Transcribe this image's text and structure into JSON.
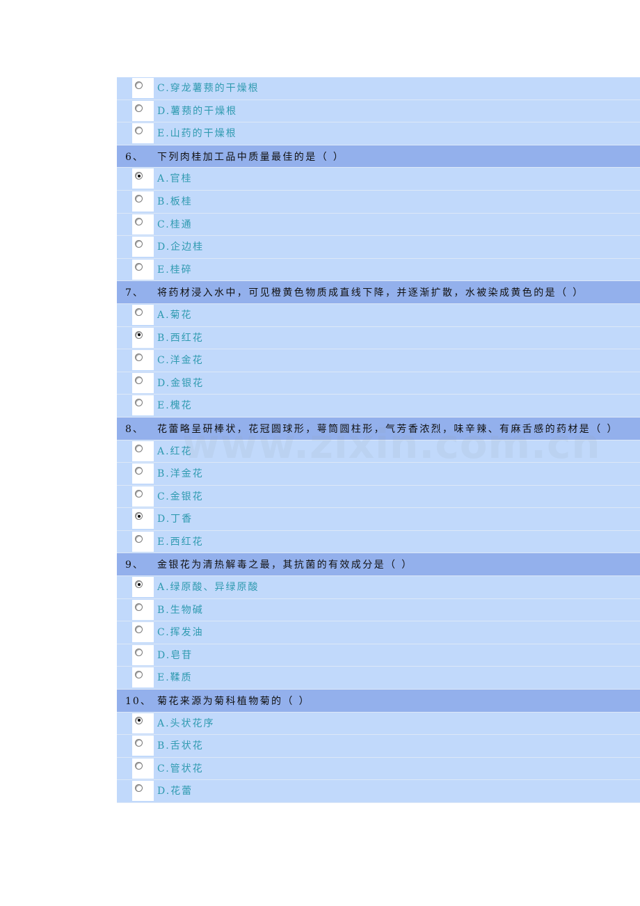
{
  "quiz": [
    {
      "type": "option",
      "label": "C.穿龙薯蓣的干燥根",
      "checked": false
    },
    {
      "type": "option",
      "label": "D.薯蓣的干燥根",
      "checked": false
    },
    {
      "type": "option",
      "label": "E.山药的干燥根",
      "checked": false
    },
    {
      "type": "question",
      "number": "6、",
      "text": "下列肉桂加工品中质量最佳的是（  ）"
    },
    {
      "type": "option",
      "label": "A.官桂",
      "checked": true
    },
    {
      "type": "option",
      "label": "B.板桂",
      "checked": false
    },
    {
      "type": "option",
      "label": "C.桂通",
      "checked": false
    },
    {
      "type": "option",
      "label": "D.企边桂",
      "checked": false
    },
    {
      "type": "option",
      "label": "E.桂碎",
      "checked": false
    },
    {
      "type": "question",
      "number": "7、",
      "text": "将药材浸入水中，可见橙黄色物质成直线下降，并逐渐扩散，水被染成黄色的是（  ）"
    },
    {
      "type": "option",
      "label": "A.菊花",
      "checked": false
    },
    {
      "type": "option",
      "label": "B.西红花",
      "checked": true
    },
    {
      "type": "option",
      "label": "C.洋金花",
      "checked": false
    },
    {
      "type": "option",
      "label": "D.金银花",
      "checked": false
    },
    {
      "type": "option",
      "label": "E.槐花",
      "checked": false
    },
    {
      "type": "question",
      "number": "8、",
      "text": "花蕾略呈研棒状，花冠圆球形，萼筒圆柱形，气芳香浓烈，味辛辣、有麻舌感的药材是（  ）"
    },
    {
      "type": "option",
      "label": "A.红花",
      "checked": false
    },
    {
      "type": "option",
      "label": "B.洋金花",
      "checked": false
    },
    {
      "type": "option",
      "label": "C.金银花",
      "checked": false
    },
    {
      "type": "option",
      "label": "D.丁香",
      "checked": true
    },
    {
      "type": "option",
      "label": "E.西红花",
      "checked": false
    },
    {
      "type": "question",
      "number": "9、",
      "text": "金银花为清热解毒之最，其抗菌的有效成分是（  ）"
    },
    {
      "type": "option",
      "label": "A.绿原酸、异绿原酸",
      "checked": true
    },
    {
      "type": "option",
      "label": "B.生物碱",
      "checked": false
    },
    {
      "type": "option",
      "label": "C.挥发油",
      "checked": false
    },
    {
      "type": "option",
      "label": "D.皂苷",
      "checked": false
    },
    {
      "type": "option",
      "label": "E.鞣质",
      "checked": false
    },
    {
      "type": "question",
      "number": "10、",
      "text": "菊花来源为菊科植物菊的（  ）"
    },
    {
      "type": "option",
      "label": "A.头状花序",
      "checked": true
    },
    {
      "type": "option",
      "label": "B.舌状花",
      "checked": false
    },
    {
      "type": "option",
      "label": "C.管状花",
      "checked": false
    },
    {
      "type": "option",
      "label": "D.花蕾",
      "checked": false
    }
  ],
  "watermark": "www.zixin.com.cn",
  "colors": {
    "question_row_bg": "#93b0ec",
    "option_row_bg": "#c1d9fb",
    "option_text": "#2f9ab0",
    "question_text": "#111111"
  }
}
